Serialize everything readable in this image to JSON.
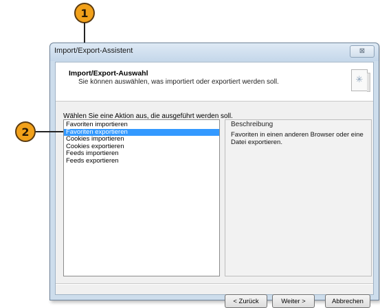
{
  "callouts": {
    "one": "1",
    "two": "2"
  },
  "window": {
    "title": "Import/Export-Assistent",
    "close_glyph": "⊠"
  },
  "header": {
    "title": "Import/Export-Auswahl",
    "subtitle": "Sie können auswählen, was importiert oder exportiert werden soll."
  },
  "prompt": "Wählen Sie eine Aktion aus, die ausgeführt werden soll.",
  "actions": {
    "items": [
      {
        "label": "Favoriten importieren"
      },
      {
        "label": "Favoriten exportieren"
      },
      {
        "label": "Cookies importieren"
      },
      {
        "label": "Cookies exportieren"
      },
      {
        "label": "Feeds importieren"
      },
      {
        "label": "Feeds exportieren"
      }
    ],
    "selected": "Favoriten exportieren"
  },
  "description": {
    "label": "Beschreibung",
    "text": "Favoriten in einen anderen Browser oder eine Datei exportieren."
  },
  "buttons": {
    "back": "< Zurück",
    "next": "Weiter >",
    "cancel": "Abbrechen"
  },
  "colors": {
    "selection": "#3399ff",
    "callout": "#f2a11a"
  }
}
